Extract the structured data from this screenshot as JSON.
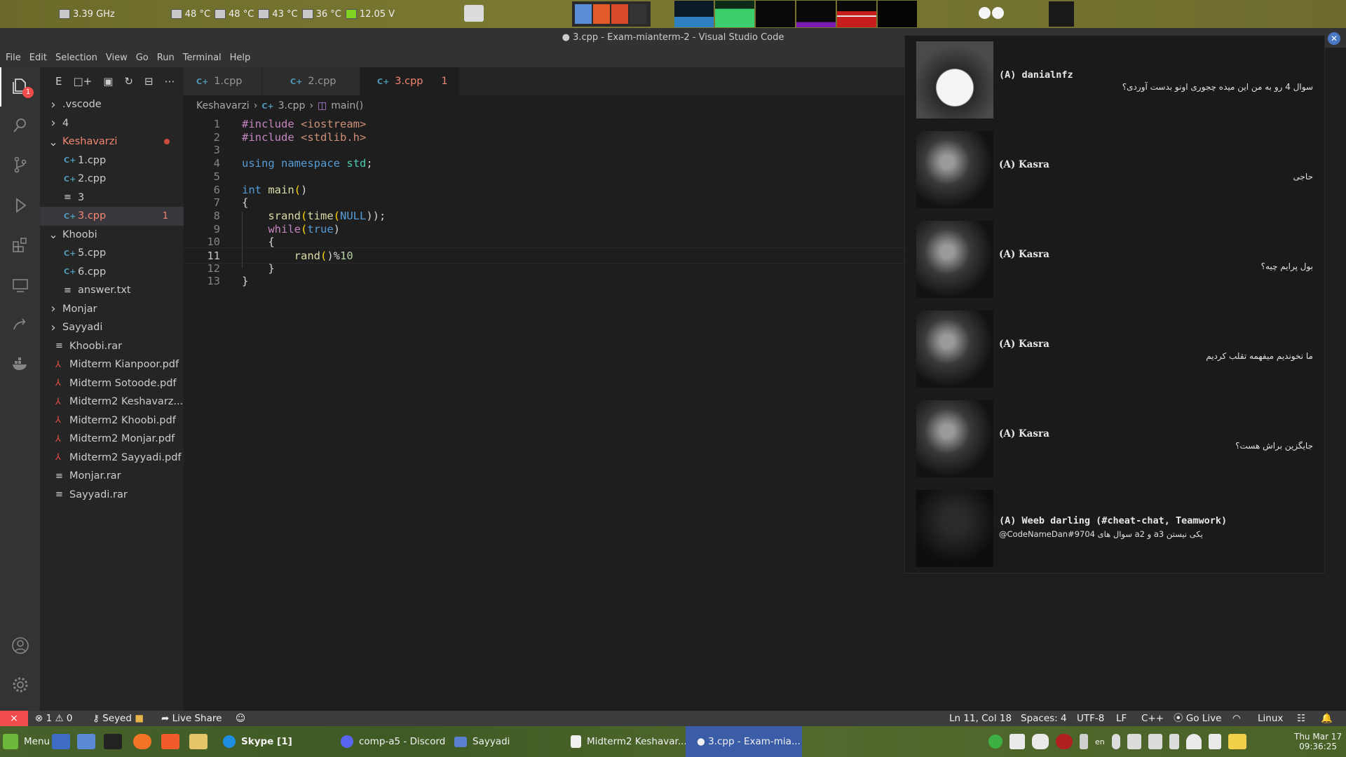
{
  "system_panel": {
    "cpu": "3.39 GHz",
    "temps": [
      "48 °C",
      "48 °C",
      "43 °C",
      "36 °C"
    ],
    "voltage": "12.05 V"
  },
  "window_title": "● 3.cpp - Exam-mianterm-2 - Visual Studio Code",
  "menu": [
    "File",
    "Edit",
    "Selection",
    "View",
    "Go",
    "Run",
    "Terminal",
    "Help"
  ],
  "activity_badge": "1",
  "sidebar": {
    "toolbar_label": "E",
    "tree": [
      {
        "label": ".vscode",
        "type": "folder-collapsed",
        "indent": 0
      },
      {
        "label": "4",
        "type": "folder-collapsed",
        "indent": 0
      },
      {
        "label": "Keshavarzi",
        "type": "folder-open",
        "indent": 0,
        "modified": true
      },
      {
        "label": "1.cpp",
        "type": "cpp",
        "indent": 1
      },
      {
        "label": "2.cpp",
        "type": "cpp",
        "indent": 1
      },
      {
        "label": "3",
        "type": "file",
        "indent": 1
      },
      {
        "label": "3.cpp",
        "type": "cpp",
        "indent": 1,
        "error": true,
        "badge": "1",
        "active": true
      },
      {
        "label": "Khoobi",
        "type": "folder-open",
        "indent": 0
      },
      {
        "label": "5.cpp",
        "type": "cpp",
        "indent": 1
      },
      {
        "label": "6.cpp",
        "type": "cpp",
        "indent": 1
      },
      {
        "label": "answer.txt",
        "type": "file",
        "indent": 1
      },
      {
        "label": "Monjar",
        "type": "folder-collapsed",
        "indent": 0
      },
      {
        "label": "Sayyadi",
        "type": "folder-collapsed",
        "indent": 0
      },
      {
        "label": "Khoobi.rar",
        "type": "file",
        "indent": 0
      },
      {
        "label": "Midterm Kianpoor.pdf",
        "type": "pdf",
        "indent": 0
      },
      {
        "label": "Midterm Sotoode.pdf",
        "type": "pdf",
        "indent": 0
      },
      {
        "label": "Midterm2 Keshavarz...",
        "type": "pdf",
        "indent": 0
      },
      {
        "label": "Midterm2 Khoobi.pdf",
        "type": "pdf",
        "indent": 0
      },
      {
        "label": "Midterm2 Monjar.pdf",
        "type": "pdf",
        "indent": 0
      },
      {
        "label": "Midterm2 Sayyadi.pdf",
        "type": "pdf",
        "indent": 0
      },
      {
        "label": "Monjar.rar",
        "type": "file",
        "indent": 0
      },
      {
        "label": "Sayyadi.rar",
        "type": "file",
        "indent": 0
      }
    ]
  },
  "tabs": [
    {
      "label": "1.cpp",
      "active": false
    },
    {
      "label": "2.cpp",
      "active": false
    },
    {
      "label": "3.cpp",
      "active": true,
      "errors": "1",
      "modified": true
    }
  ],
  "breadcrumb": [
    "Keshavarzi",
    "3.cpp",
    "main()"
  ],
  "code_lines": [
    "#include <iostream>",
    "#include <stdlib.h>",
    "",
    "using namespace std;",
    "",
    "int main()",
    "{",
    "    srand(time(NULL));",
    "    while(true)",
    "    {",
    "        rand()%10",
    "    }",
    "}"
  ],
  "current_line": 11,
  "notifications": [
    {
      "name": "(A) danialnfz",
      "message": "سوال 4 رو به من این میده چجوری اونو بدست آوردی؟",
      "avatar": "anime"
    },
    {
      "name": "(A) Kasra",
      "message": "حاجی",
      "avatar": "photo"
    },
    {
      "name": "(A) Kasra",
      "message": "بول پرایم چیه؟",
      "avatar": "photo"
    },
    {
      "name": "(A) Kasra",
      "message": "ما نخوندیم میفهمه تقلب کردیم",
      "avatar": "photo"
    },
    {
      "name": "(A) Kasra",
      "message": "جایگزین براش هست؟",
      "avatar": "photo"
    },
    {
      "name": "(A) Weeb darling (#cheat-chat, Teamwork)",
      "message": "@CodeNameDan#9704 سوال های a2 و a3 یکی نیستن",
      "avatar": "dark"
    }
  ],
  "statusbar": {
    "errors": "1",
    "warnings": "0",
    "user": "Seyed",
    "live_share": "Live Share",
    "position": "Ln 11, Col 18",
    "spaces": "Spaces: 4",
    "encoding": "UTF-8",
    "eol": "LF",
    "language": "C++",
    "go_live": "Go Live",
    "platform": "Linux"
  },
  "taskbar": {
    "menu": "Menu",
    "items": [
      "Skype [1]",
      "comp-a5 - Discord",
      "Sayyadi",
      "Midterm2 Keshavar...",
      "● 3.cpp - Exam-mia..."
    ],
    "lang": "en",
    "date": "Thu Mar 17",
    "time": "09:36:25"
  },
  "colors": {
    "accent_error": "#f48771",
    "remote": "#f14c4c",
    "taskbar_active": "#3b5da8"
  }
}
